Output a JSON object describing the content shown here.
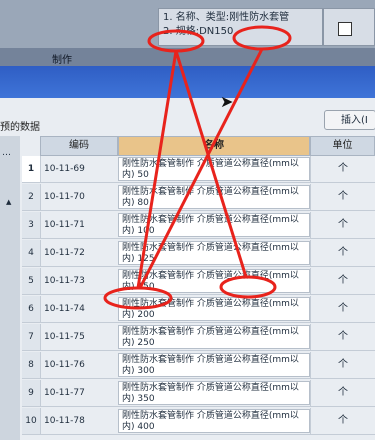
{
  "top_table": {
    "description_line1": "1. 名称、类型:刚性防水套管",
    "description_line2": "2. 规格:DN150",
    "make_label": "制作"
  },
  "panel": {
    "title": "预的数据",
    "insert_button": "插入(I",
    "left_strip_dots": "…"
  },
  "grid": {
    "headers": {
      "code": "编码",
      "name": "名称",
      "unit": "单位"
    },
    "rows": [
      {
        "num": "1",
        "code": "10-11-69",
        "name": "刚性防水套管制作 介质管道公称直径(mm以内) 50",
        "unit": "个"
      },
      {
        "num": "2",
        "code": "10-11-70",
        "name": "刚性防水套管制作 介质管道公称直径(mm以内) 80",
        "unit": "个"
      },
      {
        "num": "3",
        "code": "10-11-71",
        "name": "刚性防水套管制作 介质管道公称直径(mm以内) 100",
        "unit": "个"
      },
      {
        "num": "4",
        "code": "10-11-72",
        "name": "刚性防水套管制作 介质管道公称直径(mm以内) 125",
        "unit": "个"
      },
      {
        "num": "5",
        "code": "10-11-73",
        "name": "刚性防水套管制作 介质管道公称直径(mm以内) 150",
        "unit": "个"
      },
      {
        "num": "6",
        "code": "10-11-74",
        "name": "刚性防水套管制作 介质管道公称直径(mm以内) 200",
        "unit": "个"
      },
      {
        "num": "7",
        "code": "10-11-75",
        "name": "刚性防水套管制作 介质管道公称直径(mm以内) 250",
        "unit": "个"
      },
      {
        "num": "8",
        "code": "10-11-76",
        "name": "刚性防水套管制作 介质管道公称直径(mm以内) 300",
        "unit": "个"
      },
      {
        "num": "9",
        "code": "10-11-77",
        "name": "刚性防水套管制作 介质管道公称直径(mm以内) 350",
        "unit": "个"
      },
      {
        "num": "10",
        "code": "10-11-78",
        "name": "刚性防水套管制作 介质管道公称直径(mm以内) 400",
        "unit": "个"
      }
    ]
  },
  "annotation_color": "#e8231c"
}
